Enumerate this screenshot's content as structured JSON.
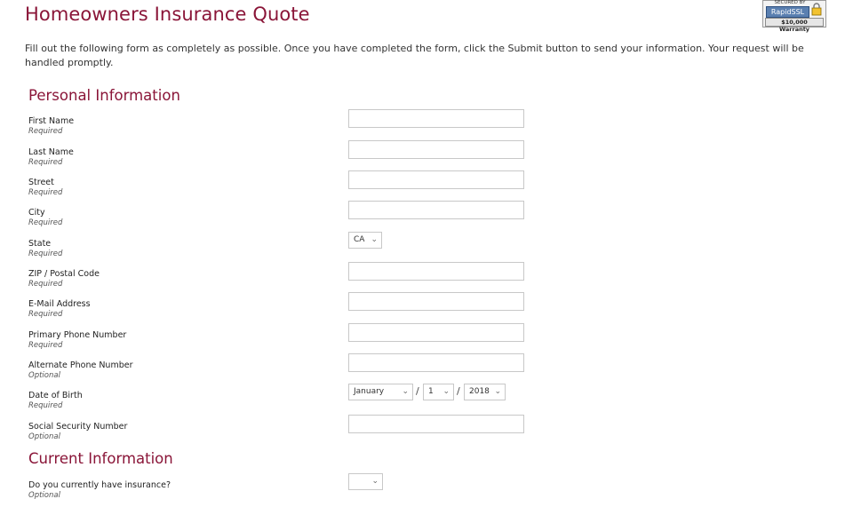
{
  "header": {
    "title": "Homeowners Insurance Quote",
    "badge": {
      "secured_text": "SECURED BY",
      "brand_text": "RapidSSL",
      "warranty_text": "$10,000 Warranty",
      "icon": "lock-icon"
    }
  },
  "intro_text": "Fill out the following form as completely as possible. Once you have completed the form, click the Submit button to send your information. Your request will be handled promptly.",
  "sections": {
    "personal_title": "Personal Information",
    "current_title": "Current Information"
  },
  "fields": [
    {
      "label": "First Name",
      "note": "Required",
      "value": ""
    },
    {
      "label": "Last Name",
      "note": "Required",
      "value": ""
    },
    {
      "label": "Street",
      "note": "Required",
      "value": ""
    },
    {
      "label": "City",
      "note": "Required",
      "value": ""
    },
    {
      "label": "State",
      "note": "Required",
      "value": "CA"
    },
    {
      "label": "ZIP / Postal Code",
      "note": "Required",
      "value": ""
    },
    {
      "label": "E-Mail Address",
      "note": "Required",
      "value": ""
    },
    {
      "label": "Primary Phone Number",
      "note": "Required",
      "value": ""
    },
    {
      "label": "Alternate Phone Number",
      "note": "Optional",
      "value": ""
    },
    {
      "label": "Date of Birth",
      "note": "Required",
      "month": "January",
      "day": "1",
      "year": "2018",
      "separator": "/"
    },
    {
      "label": "Social Security Number",
      "note": "Optional",
      "value": ""
    }
  ],
  "current_fields": [
    {
      "label": "Do you currently have insurance?",
      "note": "Optional",
      "value": ""
    }
  ],
  "colors": {
    "accent": "#8a1538",
    "input_border": "#c8c8c8"
  }
}
